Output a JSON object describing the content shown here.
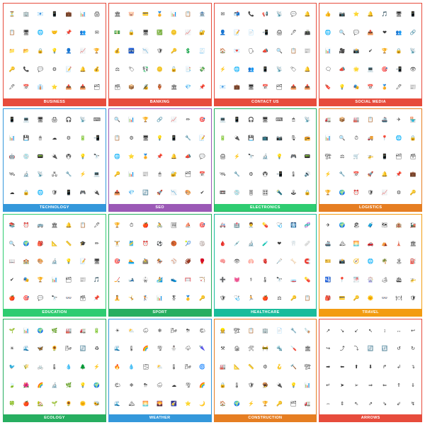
{
  "categories": [
    {
      "id": "business",
      "label": "BUSINESS",
      "cardClass": "card-business",
      "lblClass": "lbl-business",
      "icons": [
        "⏳",
        "🏢",
        "📧",
        "📱",
        "💼",
        "📊",
        "🖨",
        "📋",
        "🖥",
        "🌐",
        "🤝",
        "📌",
        "👥",
        "✉",
        "📁",
        "📂",
        "🔒",
        "💡",
        "👤",
        "📈",
        "🏆",
        "🔑",
        "📞",
        "💬",
        "⚙",
        "📝",
        "🔔",
        "💰",
        "🖊",
        "📅",
        "👔",
        "⭐",
        "📤",
        "📥",
        "🗂"
      ]
    },
    {
      "id": "banking",
      "label": "BANKING",
      "cardClass": "card-banking",
      "lblClass": "lbl-banking",
      "icons": [
        "🏛",
        "🐷",
        "💳",
        "🏅",
        "📊",
        "📋",
        "🏦",
        "💵",
        "🔒",
        "🖥",
        "💹",
        "🪙",
        "📈",
        "🔐",
        "💰",
        "🏧",
        "📉",
        "🛡",
        "🔑",
        "💲",
        "🧾",
        "⚖",
        "🏷",
        "💱",
        "🪙",
        "🔓",
        "📑",
        "💸",
        "🗃",
        "📦",
        "🔏",
        "🏺",
        "🏛",
        "💎",
        "📌"
      ]
    },
    {
      "id": "contact",
      "label": "CONTACT US",
      "cardClass": "card-contact",
      "lblClass": "lbl-contact",
      "icons": [
        "✉",
        "📬",
        "📞",
        "📢",
        "📡",
        "💬",
        "🔔",
        "👤",
        "📝",
        "📄",
        "📲",
        "🖨",
        "🖊",
        "📠",
        "🏠",
        "💌",
        "🗣",
        "📣",
        "🔍",
        "📋",
        "📰",
        "⚡",
        "🌐",
        "👥",
        "📱",
        "📡",
        "🏷",
        "🔔",
        "📧",
        "💼",
        "🖥",
        "📅",
        "🗂",
        "📤",
        "📥"
      ]
    },
    {
      "id": "social",
      "label": "SOCIAL MEDIA",
      "cardClass": "card-social",
      "lblClass": "lbl-social",
      "icons": [
        "👍",
        "📷",
        "⭐",
        "🔔",
        "🎵",
        "🖥",
        "📱",
        "🌐",
        "🔍",
        "💬",
        "📤",
        "❤",
        "👥",
        "🔗",
        "📊",
        "🎥",
        "📸",
        "✔",
        "🏆",
        "🔒",
        "📡",
        "🗨",
        "📣",
        "🌟",
        "💻",
        "🎯",
        "📲",
        "👁",
        "🔖",
        "💡",
        "🎭",
        "📅",
        "🏅",
        "🖊",
        "📰"
      ]
    },
    {
      "id": "technology",
      "label": "TECHNOLOGY",
      "cardClass": "card-technology",
      "lblClass": "lbl-technology",
      "icons": [
        "📱",
        "💻",
        "🖥",
        "🖨",
        "🎧",
        "📡",
        "⌨",
        "📊",
        "💾",
        "🖱",
        "☁",
        "⚙",
        "🔋",
        "📲",
        "🤖",
        "💿",
        "📟",
        "🔌",
        "🖲",
        "💡",
        "🔭",
        "🛰",
        "🔬",
        "📡",
        "🖧",
        "🔧",
        "⚡",
        "💻",
        "☁",
        "🔒",
        "🌐",
        "🛡",
        "📱",
        "🎮",
        "🔌"
      ]
    },
    {
      "id": "seo",
      "label": "SEO",
      "cardClass": "card-seo",
      "lblClass": "lbl-seo",
      "icons": [
        "🔍",
        "📊",
        "🏆",
        "🔗",
        "📈",
        "✏",
        "🎯",
        "📋",
        "⚙",
        "🖥",
        "💡",
        "📱",
        "🔧",
        "📝",
        "🌐",
        "⭐",
        "🏅",
        "📌",
        "🔔",
        "📣",
        "💬",
        "🔑",
        "📊",
        "📰",
        "🖱",
        "🔐",
        "🗂",
        "📅",
        "📤",
        "💎",
        "🔄",
        "🚀",
        "📉",
        "🎨",
        "✔"
      ]
    },
    {
      "id": "electronics",
      "label": "ELECTRONICS",
      "cardClass": "card-electronics",
      "lblClass": "lbl-electronics",
      "icons": [
        "💻",
        "📱",
        "🎧",
        "🖥",
        "⌨",
        "🖱",
        "📡",
        "🔋",
        "🔌",
        "💾",
        "📺",
        "📷",
        "🎙",
        "📻",
        "🖨",
        "⚡",
        "🔭",
        "🔬",
        "💡",
        "🎮",
        "📟",
        "🛰",
        "🔧",
        "⚙",
        "🖲",
        "📲",
        "🌡",
        "🔊",
        "📼",
        "💿",
        "🎚",
        "🎛",
        "🔦",
        "🕹",
        "🔒"
      ]
    },
    {
      "id": "logistics",
      "label": "LOGISTICS",
      "cardClass": "card-logistics",
      "lblClass": "lbl-logistics",
      "icons": [
        "🚛",
        "📦",
        "🏭",
        "📋",
        "🚢",
        "✈",
        "🏪",
        "📊",
        "🔍",
        "⏱",
        "🚚",
        "📍",
        "🌐",
        "🔒",
        "🏗",
        "⚖",
        "🛒",
        "🚁",
        "📱",
        "🗂",
        "🗃",
        "⚡",
        "🔧",
        "📅",
        "🚀",
        "🔔",
        "📌",
        "💼",
        "🏆",
        "🌍",
        "⏰",
        "🛡",
        "📈",
        "⚙",
        "🔑"
      ]
    },
    {
      "id": "education",
      "label": "EDUCATION",
      "cardClass": "card-education",
      "lblClass": "lbl-education",
      "icons": [
        "📚",
        "⏰",
        "🚌",
        "🏛",
        "🔔",
        "📋",
        "🖊",
        "🔍",
        "🌍",
        "🎒",
        "📐",
        "📏",
        "🎓",
        "✏",
        "📖",
        "🏫",
        "🎨",
        "🔬",
        "💡",
        "📝",
        "🖥",
        "✔",
        "🎭",
        "🏆",
        "📊",
        "🗂",
        "📰",
        "🎵",
        "🍎",
        "🎯",
        "💬",
        "🔭",
        "👓",
        "🗃",
        "📌"
      ]
    },
    {
      "id": "sport",
      "label": "SPORT",
      "cardClass": "card-sport",
      "lblClass": "lbl-sport",
      "icons": [
        "🏆",
        "⏱",
        "🍎",
        "🚴",
        "🖼",
        "⛵",
        "🎯",
        "🏋",
        "🎽",
        "⏰",
        "⚽",
        "🏀",
        "🎾",
        "🏐",
        "🎯",
        "🏊",
        "🚵",
        "🏇",
        "⚾",
        "🏈",
        "🥊",
        "🏒",
        "🎿",
        "🥋",
        "🏄",
        "👟",
        "🥅",
        "🏹",
        "🧘",
        "🤸",
        "🏌",
        "📊",
        "🎖",
        "🥇",
        "🔑"
      ]
    },
    {
      "id": "healthcare",
      "label": "HEALTHCARE",
      "cardClass": "card-healthcare",
      "lblClass": "lbl-healthcare",
      "icons": [
        "🚑",
        "🏥",
        "👨‍⚕️",
        "💊",
        "🩺",
        "🩻",
        "🧬",
        "🩸",
        "💉",
        "🔬",
        "🧪",
        "❤",
        "🦷",
        "🩹",
        "🧠",
        "👁",
        "🫁",
        "🫀",
        "🩼",
        "🦴",
        "🧲",
        "➕",
        "💓",
        "⚕",
        "🌡",
        "🔭",
        "🧫",
        "💊",
        "🛡",
        "🩺",
        "🏃",
        "🍎",
        "⚖",
        "🔑",
        "📋"
      ]
    },
    {
      "id": "travel",
      "label": "TRAVEL",
      "cardClass": "card-travel",
      "lblClass": "lbl-travel",
      "icons": [
        "✈",
        "🌍",
        "🏖",
        "🧳",
        "🗺",
        "🏨",
        "🚂",
        "🚢",
        "🏔",
        "🌅",
        "🚗",
        "⛺",
        "🗼",
        "🏛",
        "🎫",
        "📸",
        "🧭",
        "🌐",
        "🌴",
        "🏝",
        "⛽",
        "🛂",
        "📍",
        "🌁",
        "🎡",
        "🏕",
        "🛳",
        "🚁",
        "🎒",
        "💳",
        "🔑",
        "🌞",
        "👓",
        "🍽",
        "🛡"
      ]
    },
    {
      "id": "ecology",
      "label": "ECOLOGY",
      "cardClass": "card-ecology",
      "lblClass": "lbl-ecology",
      "icons": [
        "🌱",
        "📊",
        "🌍",
        "🌿",
        "🏭",
        "🚛",
        "🔋",
        "☀",
        "🌊",
        "🦋",
        "🌻",
        "🌬",
        "🔄",
        "♻",
        "🐦",
        "🌾",
        "🚲",
        "🌡",
        "💧",
        "🌲",
        "⚡",
        "🍃",
        "🌺",
        "🌈",
        "🔬",
        "🌿",
        "💡",
        "🌍",
        "🍀",
        "🍎",
        "🏡",
        "🌱",
        "🌻",
        "🌞",
        "🐝"
      ]
    },
    {
      "id": "weather",
      "label": "WEATHER",
      "cardClass": "card-weather",
      "lblClass": "lbl-weather",
      "icons": [
        "☀",
        "⛅",
        "🌧",
        "❄",
        "🌬",
        "⛈",
        "🌤",
        "🌊",
        "🌡",
        "🌈",
        "🌪",
        "⛄",
        "🌩",
        "🌂",
        "🔥",
        "💧",
        "🌫",
        "⛅",
        "🌡",
        "🌬",
        "🌀",
        "🌤",
        "❄",
        "⛈",
        "🌧",
        "☁",
        "🌪",
        "🌈",
        "🌊",
        "🏔",
        "🌅",
        "🌄",
        "🌠",
        "⭐",
        "🌙"
      ]
    },
    {
      "id": "construction",
      "label": "CONSTRUCTION",
      "cardClass": "card-construction",
      "lblClass": "lbl-construction",
      "icons": [
        "👷",
        "🏗",
        "📋",
        "🏢",
        "📄",
        "🔧",
        "🪚",
        "⚒",
        "🏚",
        "🛠",
        "🚧",
        "🔩",
        "🪛",
        "🏛",
        "🏭",
        "📐",
        "📏",
        "⚙",
        "🪝",
        "🔨",
        "🏗",
        "🔒",
        "🌡",
        "🛡",
        "🪤",
        "🔌",
        "💡",
        "📊",
        "🏠",
        "🌍",
        "⚡",
        "🏆",
        "🔑",
        "🗂",
        "🚛"
      ]
    },
    {
      "id": "arrows",
      "label": "ARROWS",
      "cardClass": "card-arrows",
      "lblClass": "lbl-arrows",
      "icons": [
        "↗",
        "↘",
        "↙",
        "↖",
        "↕",
        "↔",
        "↩",
        "↪",
        "⤴",
        "⤵",
        "🔄",
        "🔃",
        "↺",
        "↻",
        "➡",
        "⬅",
        "⬆",
        "⬇",
        "↱",
        "↲",
        "↴",
        "↵",
        "➤",
        "➢",
        "⇒",
        "⇐",
        "⇑",
        "⇓",
        "⇔",
        "⇕",
        "⇖",
        "⇗",
        "⇘",
        "⇙",
        "↯"
      ]
    }
  ]
}
